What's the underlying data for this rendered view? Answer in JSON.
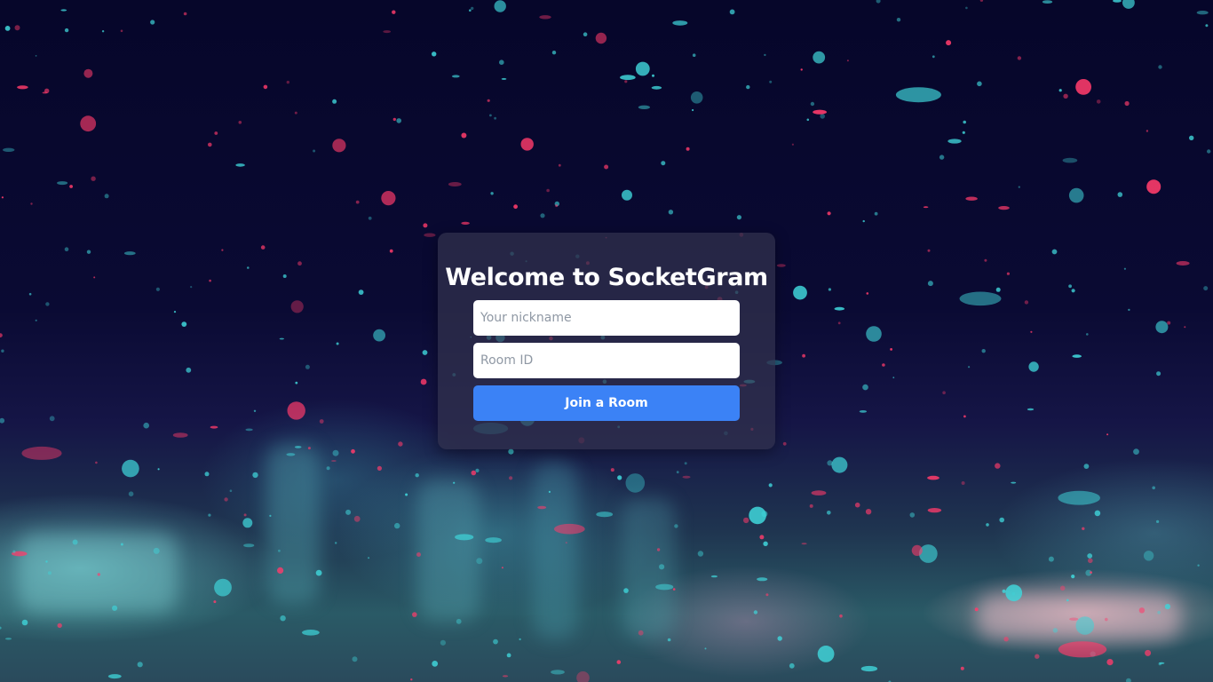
{
  "login": {
    "title": "Welcome to SocketGram",
    "nickname_placeholder": "Your nickname",
    "nickname_value": "",
    "room_placeholder": "Room ID",
    "room_value": "",
    "join_label": "Join a Room"
  },
  "colors": {
    "button": "#3b82f6",
    "card": "rgba(50,50,78,0.72)",
    "background_top": "#06062a",
    "drop_pink": "#ff3b6b",
    "drop_cyan": "#3fd3d8"
  }
}
